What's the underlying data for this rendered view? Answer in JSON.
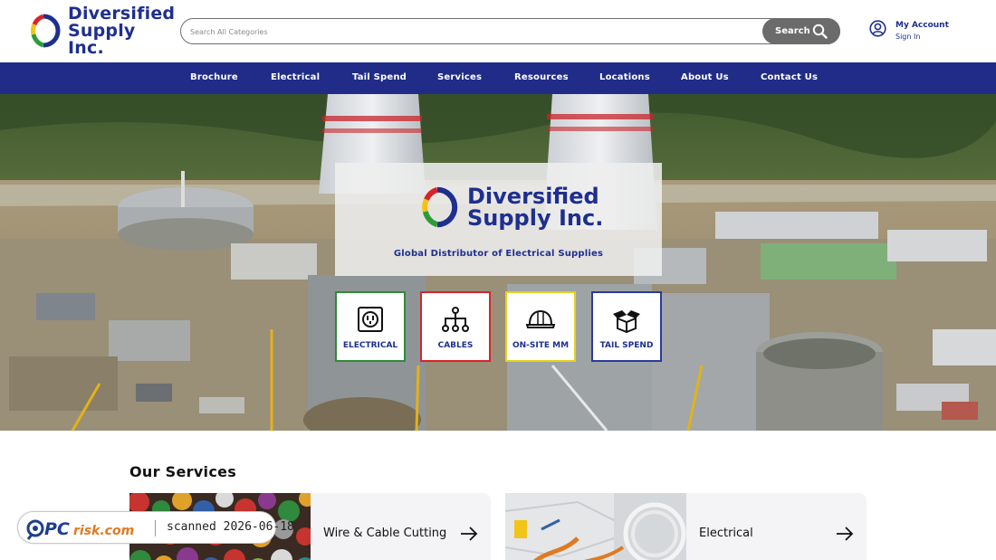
{
  "header": {
    "logo": {
      "line1": "Diversified",
      "line2": "Supply Inc."
    },
    "search": {
      "placeholder": "Search All Categories",
      "value": "",
      "button_label": "Search"
    },
    "account": {
      "title": "My Account",
      "subtitle": "Sign In"
    }
  },
  "nav": {
    "items": [
      {
        "label": "Brochure"
      },
      {
        "label": "Electrical"
      },
      {
        "label": "Tail Spend"
      },
      {
        "label": "Services"
      },
      {
        "label": "Resources"
      },
      {
        "label": "Locations"
      },
      {
        "label": "About Us"
      },
      {
        "label": "Contact Us"
      }
    ]
  },
  "hero": {
    "logo": {
      "line1": "Diversified",
      "line2": "Supply Inc."
    },
    "tagline": "Global Distributor of Electrical Supplies",
    "tiles": [
      {
        "label": "ELECTRICAL",
        "icon": "outlet-icon",
        "border_color": "#2e8b3a"
      },
      {
        "label": "CABLES",
        "icon": "cable-network-icon",
        "border_color": "#d8232a"
      },
      {
        "label": "ON-SITE MM",
        "icon": "hard-hat-icon",
        "border_color": "#e3d21c"
      },
      {
        "label": "TAIL SPEND",
        "icon": "open-box-icon",
        "border_color": "#2a3a9c"
      }
    ]
  },
  "services": {
    "title": "Our Services",
    "cards": [
      {
        "label": "Wire & Cable Cutting"
      },
      {
        "label": "Electrical"
      }
    ]
  },
  "watermark": {
    "brand": "PCrisk.com",
    "text": "scanned 2026-06-18"
  },
  "colors": {
    "brand_blue": "#1e2f8f",
    "nav_bg": "#202c88",
    "search_button": "#6b6b6b"
  }
}
